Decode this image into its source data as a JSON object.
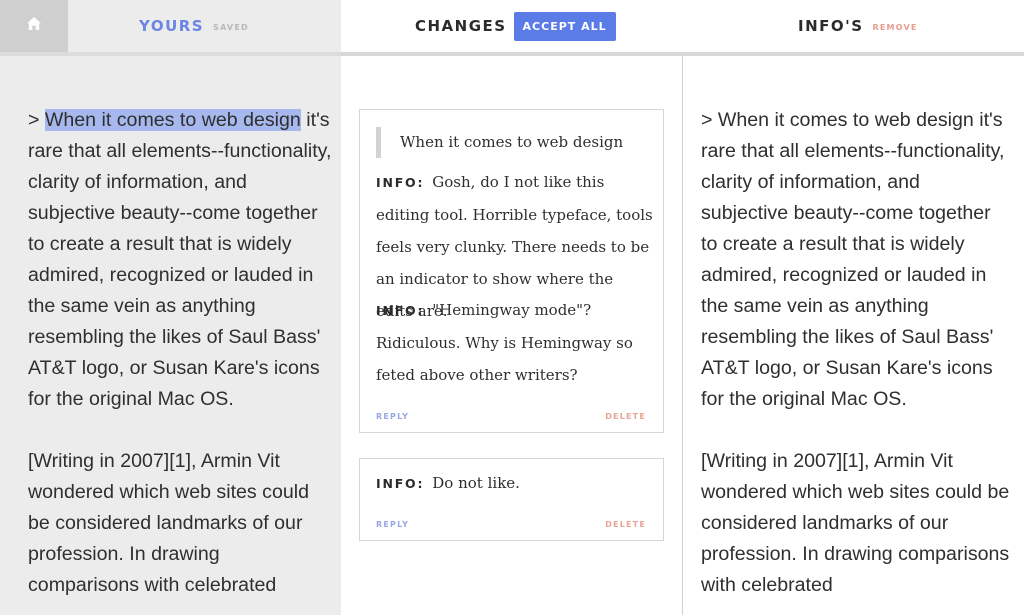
{
  "header": {
    "home_icon": "home-icon",
    "yours": {
      "title": "YOURS",
      "status": "SAVED"
    },
    "changes": {
      "title": "CHANGES",
      "accept_all_label": "ACCEPT ALL"
    },
    "infos": {
      "title": "INFO'S",
      "remove_label": "REMOVE"
    }
  },
  "colors": {
    "accent": "#5b7ce6",
    "yours_title": "#6b85e3",
    "remove": "#e79b8f",
    "highlight": "#a7b8ef"
  },
  "yours_doc": {
    "highlighted": "When it comes to web design",
    "p1_prefix": "> ",
    "p1_rest": " it's rare that all elements--functionality, clarity of information, and subjective beauty--come together to create a result that is widely admired, recognized or lauded in the same vein as anything resembling the likes of Saul Bass' AT&T logo, or Susan Kare's icons for the original Mac OS.",
    "p2": "[Writing in 2007][1], Armin Vit wondered which web sites could be considered landmarks of our profession. In drawing comparisons with celebrated"
  },
  "changes": {
    "card1": {
      "quote": "When it comes to web design",
      "comments": [
        {
          "label": "INFO:",
          "text": "Gosh, do I not like this editing tool. Horrible typeface, tools feels very clunky. There needs to be an indicator to show where the edits are."
        },
        {
          "label": "INFO:",
          "text": "\"Hemingway mode\"? Ridiculous. Why is Hemingway so feted above other writers?"
        }
      ],
      "reply_label": "REPLY",
      "delete_label": "DELETE"
    },
    "card2": {
      "comments": [
        {
          "label": "INFO:",
          "text": "Do not like."
        }
      ],
      "reply_label": "REPLY",
      "delete_label": "DELETE"
    }
  },
  "infos_doc": {
    "p1": "> When it comes to web design it's rare that all elements--functionality, clarity of information, and subjective beauty--come together to create a result that is widely admired, recognized or lauded in the same vein as anything resembling the likes of Saul Bass' AT&T logo, or Susan Kare's icons for the original Mac OS.",
    "p2": "[Writing in 2007][1], Armin Vit wondered which web sites could be considered landmarks of our profession. In drawing comparisons with celebrated"
  }
}
